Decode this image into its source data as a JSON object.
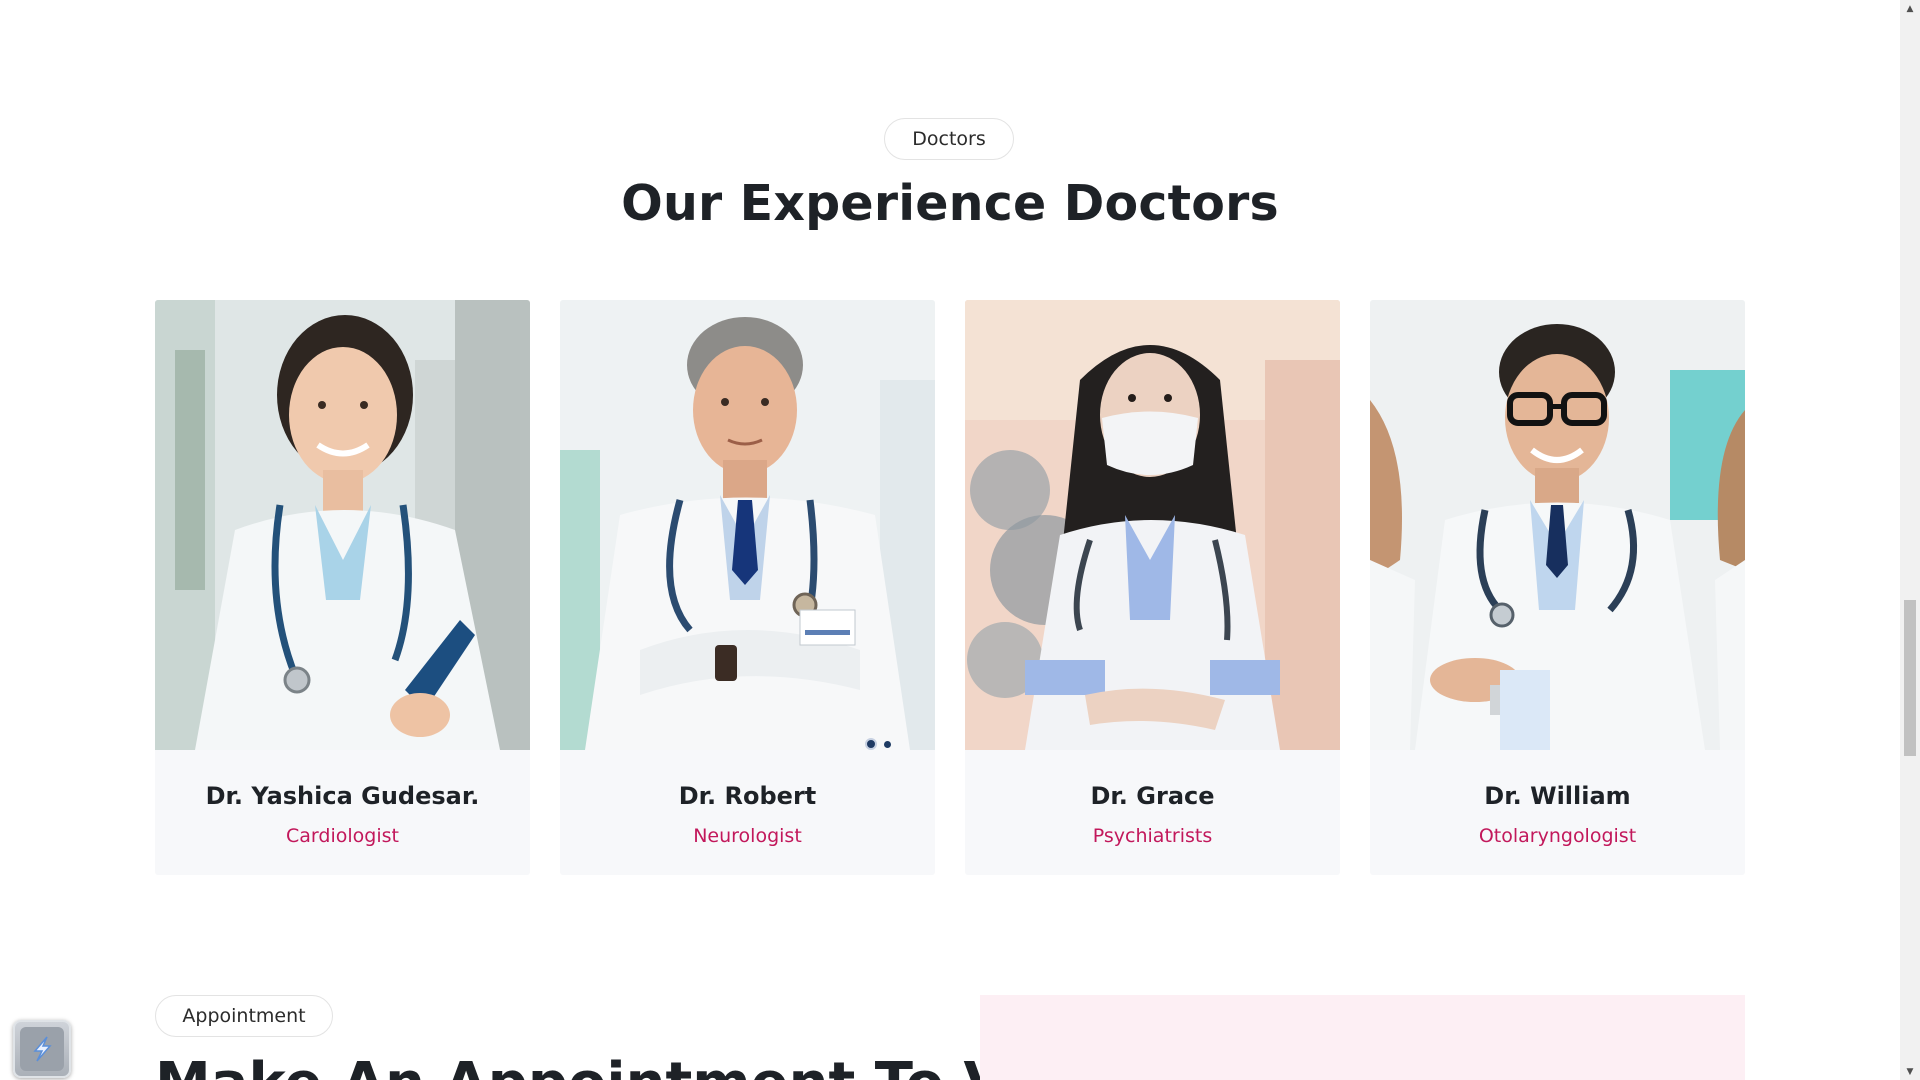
{
  "section": {
    "tag": "Doctors",
    "title": "Our Experience Doctors"
  },
  "doctors": [
    {
      "name": "Dr. Yashica Gudesar.",
      "role": "Cardiologist",
      "photo_icon": "female-doctor-photo"
    },
    {
      "name": "Dr. Robert",
      "role": "Neurologist",
      "photo_icon": "male-doctor-photo"
    },
    {
      "name": "Dr. Grace",
      "role": "Psychiatrists",
      "photo_icon": "masked-doctor-photo"
    },
    {
      "name": "Dr. William",
      "role": "Otolaryngologist",
      "photo_icon": "glasses-doctor-photo"
    }
  ],
  "slider": {
    "total_dots": 2,
    "active_dot": 1
  },
  "appointment": {
    "tag": "Appointment",
    "title": "Make An Appointment To Visit"
  },
  "colors": {
    "accent": "#c2185b",
    "heading": "#1e2227",
    "card_bg": "#f7f8fa",
    "appointment_panel": "#fdeff4"
  },
  "widget": {
    "icon": "lightning-bolt-icon"
  }
}
